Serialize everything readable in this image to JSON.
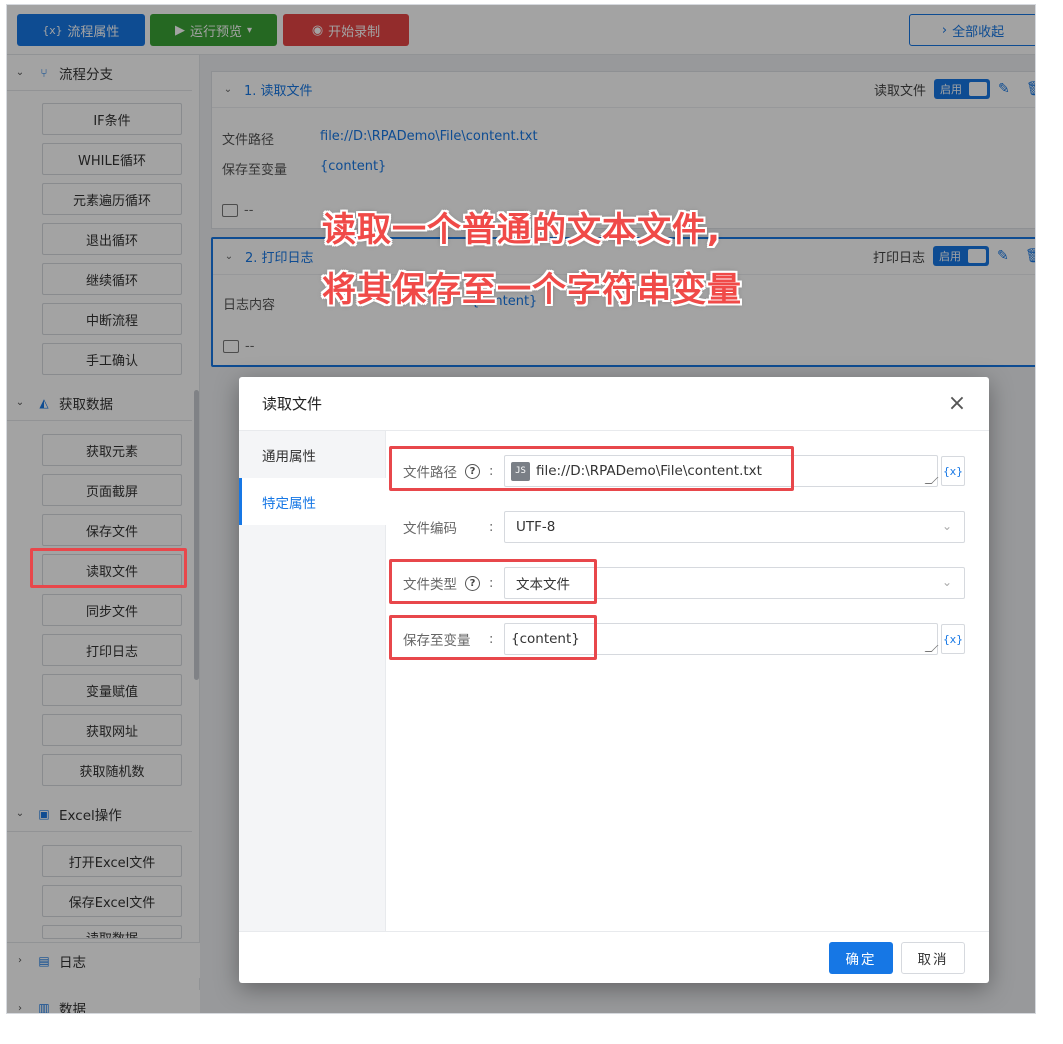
{
  "toolbar": {
    "flow_props": "流程属性",
    "flow_props_icon": "{x}",
    "run_preview": "运行预览",
    "start_record": "开始录制",
    "collapse_all": "全部收起"
  },
  "sidebar": {
    "cat_branch": "流程分支",
    "branch_items": [
      "IF条件",
      "WHILE循环",
      "元素遍历循环",
      "退出循环",
      "继续循环",
      "中断流程",
      "手工确认"
    ],
    "cat_data": "获取数据",
    "data_items": [
      "获取元素",
      "页面截屏",
      "保存文件",
      "读取文件",
      "同步文件",
      "打印日志",
      "变量赋值",
      "获取网址",
      "获取随机数"
    ],
    "cat_excel": "Excel操作",
    "excel_items": [
      "打开Excel文件",
      "保存Excel文件",
      "读取数据"
    ],
    "bottom_log": "日志",
    "bottom_data": "数据"
  },
  "steps": [
    {
      "title": "1. 读取文件",
      "type": "读取文件",
      "toggle": "启用",
      "params": [
        {
          "label": "文件路径",
          "value": "file://D:\\RPADemo\\File\\content.txt"
        },
        {
          "label": "保存至变量",
          "value": "{content}"
        }
      ],
      "note": "--"
    },
    {
      "title": "2. 打印日志",
      "type": "打印日志",
      "toggle": "启用",
      "params": [
        {
          "label": "日志内容",
          "value": "{content}"
        }
      ],
      "note": "--"
    }
  ],
  "dialog": {
    "title": "读取文件",
    "close": "×",
    "tabs": [
      "通用属性",
      "特定属性"
    ],
    "fields": {
      "path_label": "文件路径",
      "path_badge": "JS",
      "path_value": "file://D:\\RPADemo\\File\\content.txt",
      "encoding_label": "文件编码",
      "encoding_value": "UTF-8",
      "type_label": "文件类型",
      "type_value": "文本文件",
      "var_label": "保存至变量",
      "var_value": "{content}",
      "var_button": "{x}",
      "help": "?",
      "colon": ":"
    },
    "ok": "确定",
    "cancel": "取消"
  },
  "caption": {
    "line1": "读取一个普通的文本文件,",
    "line2": "将其保存至一个字符串变量"
  },
  "colors": {
    "primary": "#1677e5",
    "green": "#3aa336",
    "red": "#e64545",
    "highlight": "#e8474b"
  }
}
